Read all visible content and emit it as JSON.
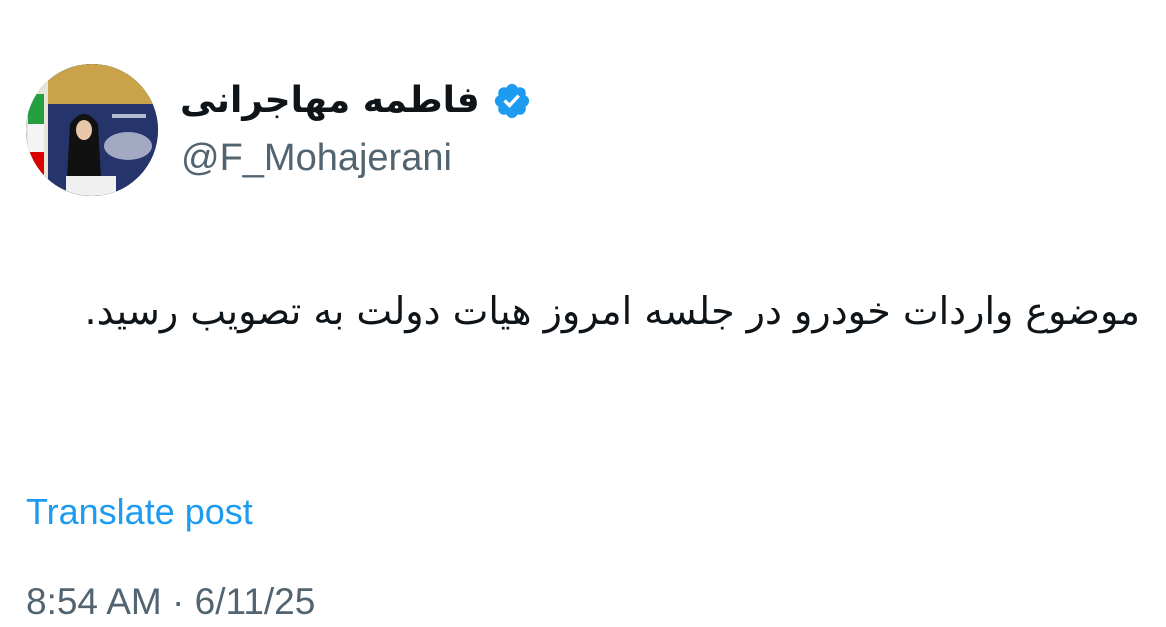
{
  "author": {
    "display_name": "فاطمه مهاجرانی",
    "handle": "@F_Mohajerani",
    "verified_icon": "verified-badge-icon",
    "avatar_icon": "profile-photo"
  },
  "post": {
    "text": "موضوع واردات خودرو در جلسه امروز هیات دولت به تصویب رسید."
  },
  "actions": {
    "translate_label": "Translate post"
  },
  "meta": {
    "timestamp": "8:54 AM · 6/11/25"
  },
  "colors": {
    "link_blue": "#1d9bf0",
    "secondary_text": "#536471",
    "primary_text": "#0f1419",
    "verified_blue": "#1d9bf0"
  }
}
